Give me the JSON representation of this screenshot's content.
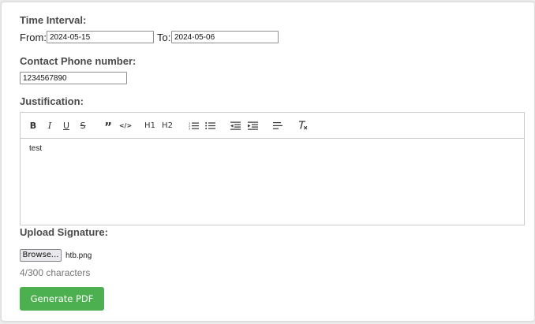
{
  "time_interval": {
    "label": "Time Interval:",
    "from_label": "From:",
    "from_value": "2024-05-15",
    "to_label": "To:",
    "to_value": "2024-05-06"
  },
  "contact": {
    "label": "Contact Phone number:",
    "value": "1234567890"
  },
  "justification": {
    "label": "Justification:",
    "content": "test",
    "toolbar": {
      "bold": "B",
      "italic": "I",
      "underline": "U",
      "strike": "S",
      "blockquote": "”",
      "code": "</>",
      "h1": "H1",
      "h2": "H2",
      "icons": [
        "bold-icon",
        "italic-icon",
        "underline-icon",
        "strikethrough-icon",
        "blockquote-icon",
        "code-block-icon",
        "heading-1-icon",
        "heading-2-icon",
        "ordered-list-icon",
        "bullet-list-icon",
        "indent-decrease-icon",
        "indent-increase-icon",
        "align-left-icon",
        "clear-format-icon"
      ]
    }
  },
  "signature": {
    "label": "Upload Signature:",
    "browse_label": "Browse...",
    "file_name": "htb.png"
  },
  "counter_text": "4/300 characters",
  "generate_label": "Generate PDF",
  "colors": {
    "accent": "#4caf50",
    "border": "#cccccc",
    "label": "#4a4a4a"
  }
}
